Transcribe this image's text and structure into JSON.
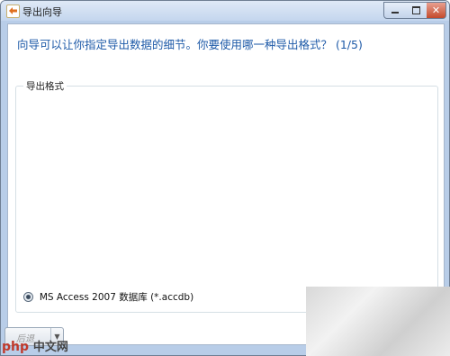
{
  "window": {
    "title": "导出向导"
  },
  "controls": {
    "close_glyph": "✕"
  },
  "main": {
    "question": "向导可以让你指定导出数据的细节。你要使用哪一种导出格式？ (1/5)",
    "group_label": "导出格式",
    "format_option": "MS Access 2007 数据库 (*.accdb)"
  },
  "footer": {
    "back_label": "后退",
    "dropdown_glyph": "▼"
  },
  "watermark": {
    "php": "php",
    "site": "中文网"
  }
}
